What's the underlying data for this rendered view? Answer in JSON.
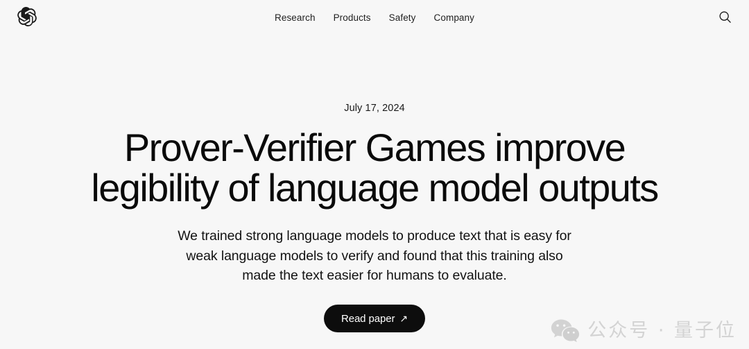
{
  "header": {
    "logo_icon": "openai-logo-icon",
    "nav_items": [
      {
        "label": "Research"
      },
      {
        "label": "Products"
      },
      {
        "label": "Safety"
      },
      {
        "label": "Company"
      }
    ],
    "search_icon": "search-icon"
  },
  "hero": {
    "date": "July 17, 2024",
    "headline": "Prover-Verifier Games improve legibility of language model outputs",
    "subtitle": "We trained strong language models to produce text that is easy for weak language models to verify and found that this training also made the text easier for humans to evaluate.",
    "cta": {
      "label": "Read paper",
      "arrow": "↗"
    }
  },
  "watermark": {
    "icon": "wechat-icon",
    "text": "公众号 · 量子位"
  },
  "colors": {
    "background": "#f7f7f7",
    "text": "#0d0d0d",
    "button_bg": "#0d0d0d",
    "button_text": "#ffffff",
    "watermark": "#d3d3d3"
  }
}
